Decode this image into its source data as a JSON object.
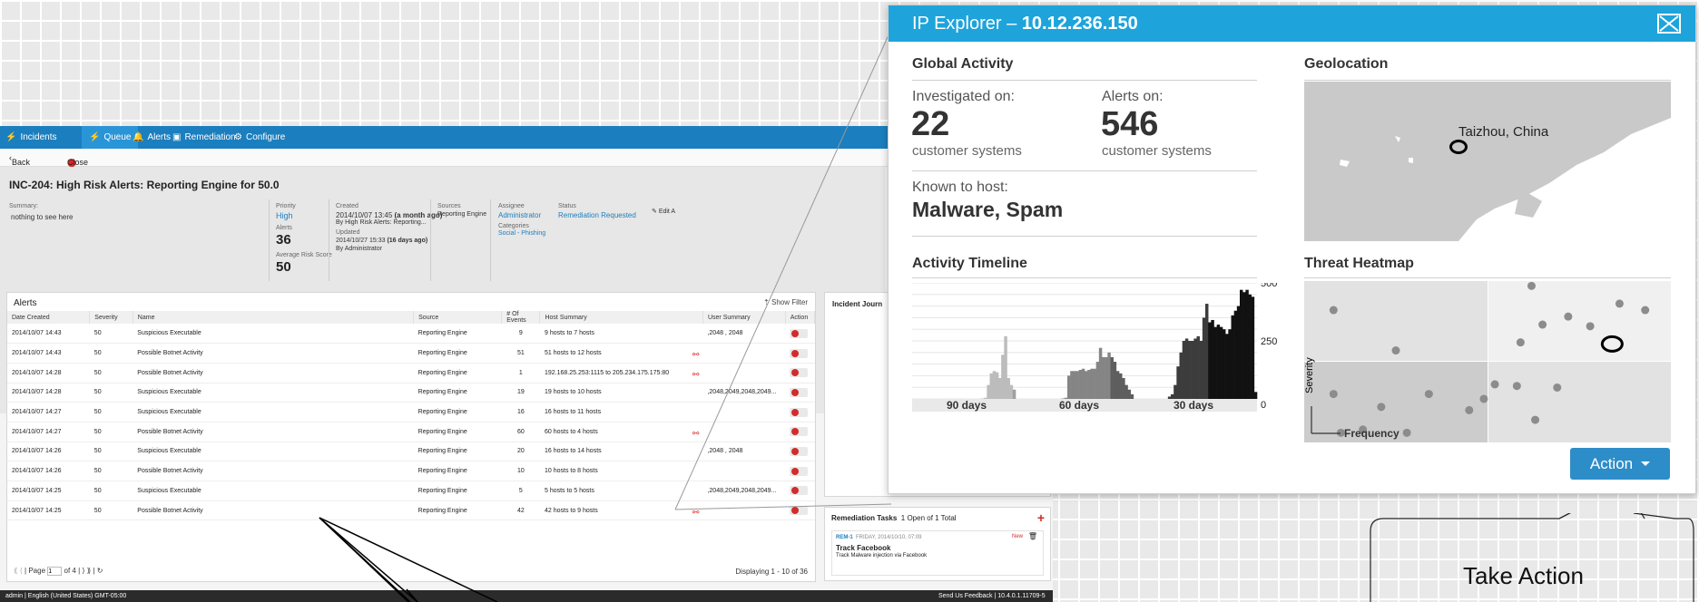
{
  "app": {
    "nav": {
      "incidents": "Incidents",
      "queue": "Queue",
      "alerts": "Alerts",
      "remediation": "Remediation",
      "configure": "Configure"
    },
    "subnav": {
      "back": "Back to Queue",
      "close": "Close Incident"
    },
    "incident": {
      "title": "INC-204:  High Risk Alerts: Reporting Engine for 50.0",
      "summary_label": "Summary:",
      "summary_value": "nothing to see here",
      "priority_label": "Priority",
      "priority_value": "High",
      "alerts_label": "Alerts",
      "alerts_value": "36",
      "avg_risk_label": "Average Risk Score",
      "avg_risk_value": "50",
      "created_label": "Created",
      "created_value": "2014/10/07 13:45",
      "created_ago": "(a month ago)",
      "created_by": "By High Risk Alerts: Reporting...",
      "updated_label": "Updated",
      "updated_value": "2014/10/27 15:33",
      "updated_ago": "(16 days ago)",
      "updated_by": "By Administrator",
      "sources_label": "Sources",
      "sources_value": "Reporting Engine",
      "assignee_label": "Assignee",
      "assignee_value": "Administrator",
      "categories_label": "Categories",
      "categories_value": "Social - Phishing",
      "status_label": "Status",
      "status_value": "Remediation Requested",
      "edit_label": "Edit A"
    },
    "alerts_panel": {
      "title": "Alerts",
      "show_filter": "Show Filter",
      "columns": [
        "Date Created",
        "Severity",
        "Name",
        "Source",
        "# Of Events",
        "Host Summary",
        "User Summary",
        "Action"
      ],
      "rows": [
        {
          "date": "2014/10/07 14:43",
          "sev": "50",
          "name": "Suspicious Executable",
          "source": "Reporting Engine",
          "events": "9",
          "host": "9 hosts to 7 hosts",
          "link": "",
          "user": ",2048 , 2048"
        },
        {
          "date": "2014/10/07 14:43",
          "sev": "50",
          "name": "Possible Botnet Activity",
          "source": "Reporting Engine",
          "events": "51",
          "host": "51 hosts to 12 hosts",
          "link": "⚯",
          "user": ""
        },
        {
          "date": "2014/10/07 14:28",
          "sev": "50",
          "name": "Possible Botnet Activity",
          "source": "Reporting Engine",
          "events": "1",
          "host": "192.168.25.253:1115 to 205.234.175.175:80",
          "link": "⚯",
          "user": ""
        },
        {
          "date": "2014/10/07 14:28",
          "sev": "50",
          "name": "Suspicious Executable",
          "source": "Reporting Engine",
          "events": "19",
          "host": "19 hosts to 10 hosts",
          "link": "",
          "user": ",2048,2049,2048,2049..."
        },
        {
          "date": "2014/10/07 14:27",
          "sev": "50",
          "name": "Suspicious Executable",
          "source": "Reporting Engine",
          "events": "16",
          "host": "16 hosts to 11 hosts",
          "link": "",
          "user": ""
        },
        {
          "date": "2014/10/07 14:27",
          "sev": "50",
          "name": "Possible Botnet Activity",
          "source": "Reporting Engine",
          "events": "60",
          "host": "60 hosts to 4 hosts",
          "link": "⚯",
          "user": ""
        },
        {
          "date": "2014/10/07 14:26",
          "sev": "50",
          "name": "Suspicious Executable",
          "source": "Reporting Engine",
          "events": "20",
          "host": "16 hosts to 14 hosts",
          "link": "",
          "user": ",2048 , 2048"
        },
        {
          "date": "2014/10/07 14:26",
          "sev": "50",
          "name": "Possible Botnet Activity",
          "source": "Reporting Engine",
          "events": "10",
          "host": "10 hosts to 8 hosts",
          "link": "",
          "user": ""
        },
        {
          "date": "2014/10/07 14:25",
          "sev": "50",
          "name": "Suspicious Executable",
          "source": "Reporting Engine",
          "events": "5",
          "host": "5 hosts to 5 hosts",
          "link": "",
          "user": ",2048,2049,2048,2049..."
        },
        {
          "date": "2014/10/07 14:25",
          "sev": "50",
          "name": "Possible Botnet Activity",
          "source": "Reporting Engine",
          "events": "42",
          "host": "42 hosts to 9 hosts",
          "link": "⚯",
          "user": ""
        }
      ],
      "pager_page": "Page",
      "pager_value": "1",
      "pager_of": "of 4",
      "displaying": "Displaying 1 - 10 of 36"
    },
    "journal": {
      "title": "Incident Journ"
    },
    "remediation": {
      "title": "Remediation Tasks",
      "count": "1 Open of 1 Total",
      "task_id": "REM-1",
      "task_date": "FRIDAY, 2014/10/10, 07:09",
      "task_status": "New",
      "task_title": "Track Facebook",
      "task_desc": "Track Malware injection via Facebook"
    },
    "footer": {
      "left": "admin  |  English (United States) GMT-05:00",
      "right": "Send Us Feedback  |  10.4.0.1.11709-5"
    }
  },
  "ip_explorer": {
    "title_prefix": "IP Explorer – ",
    "ip": "10.12.236.150",
    "global_activity": "Global Activity",
    "investigated_label": "Investigated on:",
    "investigated_value": "22",
    "investigated_sub": "customer systems",
    "alerts_label": "Alerts on:",
    "alerts_value": "546",
    "alerts_sub": "customer systems",
    "known_label": "Known to host:",
    "known_value": "Malware, Spam",
    "geolocation": "Geolocation",
    "geo_place": "Taizhou, China",
    "timeline_title": "Activity Timeline",
    "heatmap_title": "Threat Heatmap",
    "heatmap_ylabel": "Severity",
    "heatmap_xlabel": "Frequency",
    "action_label": "Action"
  },
  "callout": {
    "text": "Take Action"
  },
  "chart_data": {
    "type": "area",
    "title": "Activity Timeline",
    "xlabel": "",
    "ylabel": "",
    "ylim": [
      0,
      500
    ],
    "y_ticks": [
      "500",
      "250",
      "0"
    ],
    "x_labels": [
      "90 days",
      "60 days",
      "30 days"
    ],
    "values": [
      0,
      0,
      0,
      0,
      0,
      0,
      0,
      0,
      0,
      0,
      0,
      0,
      0,
      0,
      0,
      0,
      0,
      0,
      0,
      0,
      0,
      0,
      0,
      0,
      2,
      5,
      60,
      110,
      120,
      115,
      90,
      190,
      270,
      90,
      60,
      40,
      0,
      0,
      0,
      0,
      0,
      0,
      0,
      0,
      0,
      0,
      0,
      0,
      0,
      0,
      0,
      0,
      2,
      5,
      100,
      120,
      120,
      120,
      125,
      130,
      120,
      125,
      130,
      130,
      160,
      220,
      180,
      180,
      200,
      180,
      160,
      120,
      110,
      90,
      60,
      40,
      20,
      0,
      0,
      0,
      0,
      0,
      0,
      0,
      0,
      0,
      0,
      0,
      0,
      10,
      20,
      60,
      140,
      200,
      250,
      260,
      250,
      250,
      260,
      270,
      250,
      350,
      410,
      330,
      340,
      310,
      320,
      310,
      300,
      280,
      300,
      360,
      380,
      400,
      470,
      460,
      470,
      450,
      440,
      30
    ],
    "band_colors": [
      "#d9d9d9",
      "#bcbcbc",
      "#a0a0a0",
      "#858585",
      "#5e5e5e",
      "#3c3c3c",
      "#111111"
    ]
  },
  "heatmap_data": {
    "points": [
      [
        0.08,
        0.82
      ],
      [
        0.25,
        0.57
      ],
      [
        0.62,
        0.97
      ],
      [
        0.65,
        0.73
      ],
      [
        0.78,
        0.72
      ],
      [
        0.93,
        0.82
      ],
      [
        0.72,
        0.78
      ],
      [
        0.59,
        0.62
      ],
      [
        0.86,
        0.86
      ],
      [
        0.08,
        0.3
      ],
      [
        0.21,
        0.22
      ],
      [
        0.34,
        0.3
      ],
      [
        0.45,
        0.2
      ],
      [
        0.52,
        0.36
      ],
      [
        0.49,
        0.27
      ],
      [
        0.58,
        0.35
      ],
      [
        0.63,
        0.14
      ],
      [
        0.69,
        0.34
      ],
      [
        0.16,
        0.08
      ],
      [
        0.28,
        0.06
      ],
      [
        0.1,
        0.06
      ]
    ],
    "highlight": [
      0.84,
      0.61
    ]
  },
  "colors": {
    "nav_blue": "#1b7ebe",
    "header_blue": "#1ea4db",
    "button_blue": "#2d8dc9",
    "alert_red": "#d32b2b"
  }
}
